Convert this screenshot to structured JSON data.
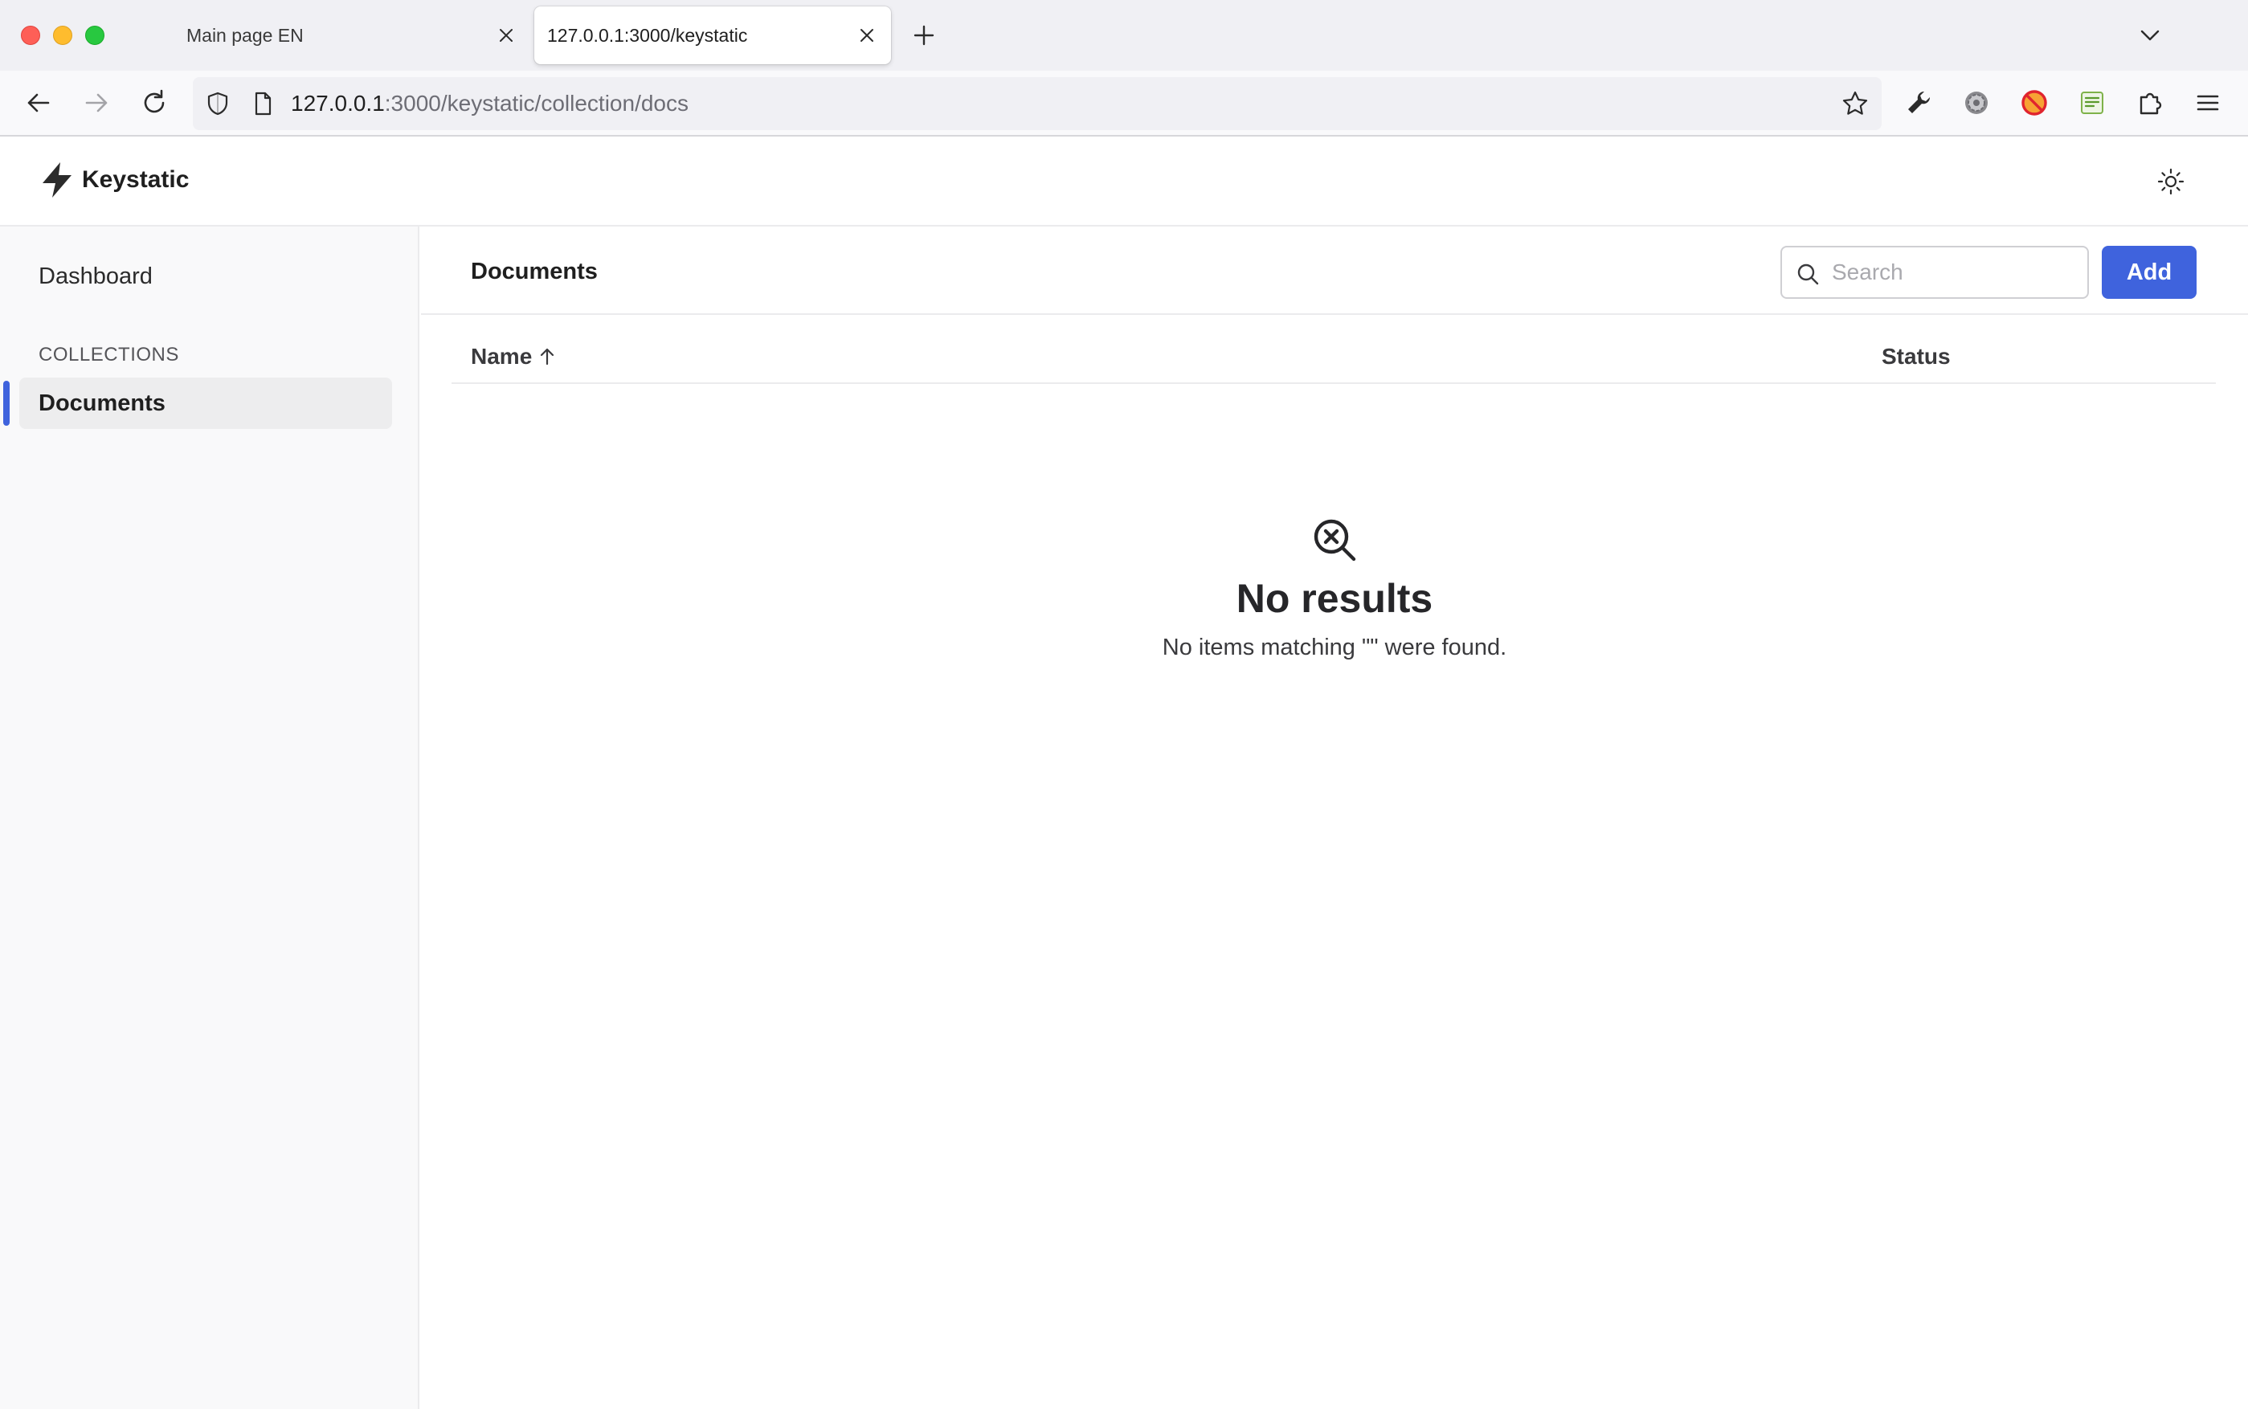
{
  "browser": {
    "tabs": [
      {
        "title": "Main page EN",
        "active": false
      },
      {
        "title": "127.0.0.1:3000/keystatic",
        "active": true
      }
    ],
    "url": {
      "host": "127.0.0.1",
      "path": ":3000/keystatic/collection/docs"
    }
  },
  "app": {
    "brand": "Keystatic",
    "sidebar": {
      "dashboard_label": "Dashboard",
      "collections_heading": "COLLECTIONS",
      "items": [
        {
          "label": "Documents",
          "active": true
        }
      ]
    },
    "main": {
      "title": "Documents",
      "search_placeholder": "Search",
      "add_label": "Add",
      "columns": {
        "name": "Name",
        "status": "Status"
      },
      "empty": {
        "title": "No results",
        "description": "No items matching \"\" were found."
      }
    }
  },
  "colors": {
    "accent": "#3f63dd",
    "sidebar_bg": "#f9f9fa",
    "tabstrip_bg": "#f0f0f4"
  },
  "icons": {
    "brand": "lightning-bolt-icon",
    "theme": "sun-icon",
    "search": "search-icon",
    "empty": "search-x-icon",
    "sort": "arrow-up-icon"
  }
}
